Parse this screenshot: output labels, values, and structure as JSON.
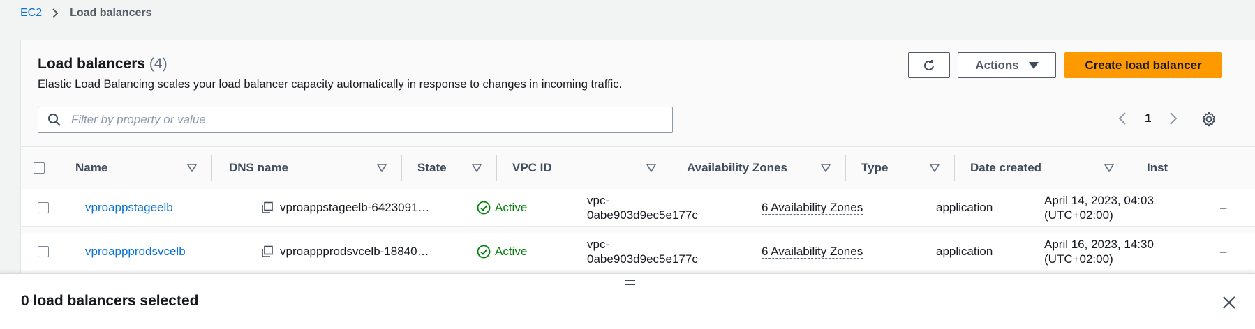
{
  "breadcrumb": {
    "root": "EC2",
    "current": "Load balancers"
  },
  "header": {
    "title": "Load balancers",
    "count": "(4)",
    "description": "Elastic Load Balancing scales your load balancer capacity automatically in response to changes in incoming traffic."
  },
  "toolbar": {
    "refresh_icon": "refresh-icon",
    "actions_label": "Actions",
    "create_label": "Create load balancer"
  },
  "search": {
    "placeholder": "Filter by property or value",
    "value": ""
  },
  "pagination": {
    "current_page": "1"
  },
  "table": {
    "columns": [
      "Name",
      "DNS name",
      "State",
      "VPC ID",
      "Availability Zones",
      "Type",
      "Date created",
      "Inst"
    ],
    "rows": [
      {
        "name": "vproappstageelb",
        "dns": "vproappstageelb-6423091…",
        "state": "Active",
        "vpc_line1": "vpc-",
        "vpc_line2": "0abe903d9ec5e177c",
        "az": "6 Availability Zones",
        "type": "application",
        "date_line1": "April 14, 2023, 04:03",
        "date_line2": "(UTC+02:00)",
        "inst": "–"
      },
      {
        "name": "vproappprodsvcelb",
        "dns": "vproappprodsvcelb-18840…",
        "state": "Active",
        "vpc_line1": "vpc-",
        "vpc_line2": "0abe903d9ec5e177c",
        "az": "6 Availability Zones",
        "type": "application",
        "date_line1": "April 16, 2023, 14:30",
        "date_line2": "(UTC+02:00)",
        "inst": "–"
      }
    ]
  },
  "split_panel": {
    "heading": "0 load balancers selected"
  },
  "colors": {
    "accent": "#0972d3",
    "primary_button": "#ff9900",
    "status_active": "#037f0c"
  }
}
